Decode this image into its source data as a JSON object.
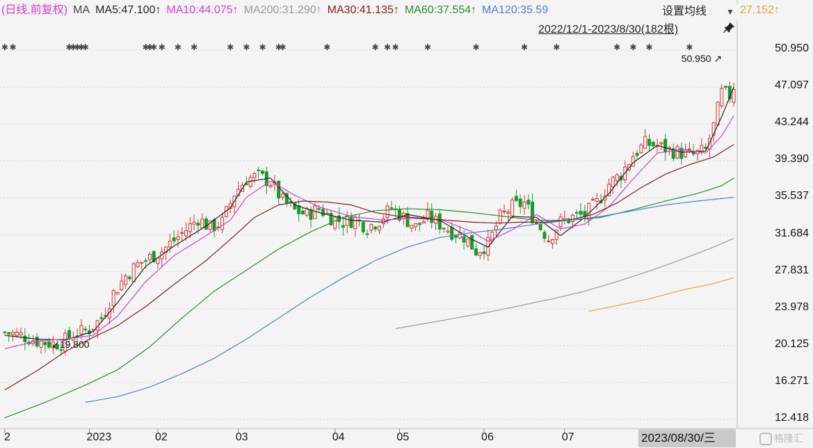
{
  "legend": {
    "prefix": "(日线,前复权)",
    "ma_label": "MA",
    "items": [
      {
        "label": "MA5:47.100↑",
        "color": "#222222"
      },
      {
        "label": "MA10:44.075↑",
        "color": "#d63bd6"
      },
      {
        "label": "MA200:31.290↑",
        "color": "#999999"
      },
      {
        "label": "MA30:41.135↑",
        "color": "#8b1a1a"
      },
      {
        "label": "MA60:37.554↑",
        "color": "#2e8b2e"
      },
      {
        "label": "MA120:35.59",
        "color": "#4a7fd4"
      },
      {
        "label": "27.152↑",
        "color": "#e8a33c"
      }
    ]
  },
  "settings_button": {
    "label": "设置均线"
  },
  "range_label": "2022/12/1-2023/8/30(182根)",
  "date_badge": "2023/08/30/三",
  "watermark": "格隆汇",
  "colors": {
    "up": "#e03030",
    "down": "#1a9a2a",
    "background": "#f4f4f4",
    "grid": "#d6d6d6"
  },
  "chart_data": {
    "type": "candlestick",
    "y_ticks": [
      "50.950",
      "47.097",
      "43.244",
      "39.390",
      "35.537",
      "31.684",
      "27.831",
      "23.978",
      "20.125",
      "16.271",
      "12.418"
    ],
    "ylim": [
      12.418,
      50.95
    ],
    "x_ticks": [
      {
        "label": "2",
        "index": 0
      },
      {
        "label": "2023",
        "index": 21
      },
      {
        "label": "02",
        "index": 38
      },
      {
        "label": "03",
        "index": 58
      },
      {
        "label": "04",
        "index": 82
      },
      {
        "label": "05",
        "index": 98
      },
      {
        "label": "06",
        "index": 119
      },
      {
        "label": "07",
        "index": 139
      },
      {
        "label": "08",
        "index": 158
      }
    ],
    "n_candles": 182,
    "annotations": [
      {
        "text": "19.800",
        "index": 14,
        "value": 19.8,
        "arrow": "↙"
      },
      {
        "text": "50.950",
        "index": 178,
        "value": 50.95,
        "arrow": "↗"
      }
    ],
    "close_anchors": [
      [
        0,
        21.5
      ],
      [
        4,
        21.2
      ],
      [
        8,
        20.6
      ],
      [
        12,
        20.3
      ],
      [
        14,
        20.4
      ],
      [
        17,
        21.3
      ],
      [
        21,
        21.8
      ],
      [
        24,
        23.0
      ],
      [
        27,
        25.6
      ],
      [
        30,
        27.4
      ],
      [
        33,
        28.6
      ],
      [
        36,
        29.3
      ],
      [
        39,
        30.0
      ],
      [
        42,
        31.1
      ],
      [
        45,
        32.2
      ],
      [
        48,
        33.4
      ],
      [
        51,
        32.4
      ],
      [
        54,
        33.0
      ],
      [
        57,
        36.0
      ],
      [
        60,
        37.5
      ],
      [
        63,
        37.8
      ],
      [
        66,
        37.2
      ],
      [
        69,
        35.2
      ],
      [
        72,
        34.2
      ],
      [
        75,
        33.8
      ],
      [
        78,
        34.4
      ],
      [
        81,
        33.5
      ],
      [
        84,
        33.0
      ],
      [
        87,
        33.3
      ],
      [
        90,
        32.5
      ],
      [
        93,
        33.2
      ],
      [
        96,
        34.5
      ],
      [
        99,
        33.5
      ],
      [
        102,
        32.5
      ],
      [
        105,
        33.5
      ],
      [
        108,
        32.8
      ],
      [
        111,
        32.0
      ],
      [
        114,
        31.5
      ],
      [
        117,
        30.0
      ],
      [
        120,
        30.7
      ],
      [
        123,
        33.5
      ],
      [
        126,
        34.6
      ],
      [
        129,
        35.0
      ],
      [
        132,
        33.0
      ],
      [
        135,
        31.3
      ],
      [
        138,
        33.0
      ],
      [
        141,
        33.5
      ],
      [
        144,
        33.8
      ],
      [
        147,
        35.0
      ],
      [
        150,
        37.0
      ],
      [
        153,
        38.0
      ],
      [
        156,
        40.0
      ],
      [
        159,
        41.2
      ],
      [
        162,
        41.0
      ],
      [
        165,
        40.5
      ],
      [
        168,
        40.2
      ],
      [
        171,
        40.0
      ],
      [
        174,
        40.5
      ],
      [
        176,
        43.0
      ],
      [
        178,
        46.5
      ],
      [
        180,
        46.2
      ],
      [
        181,
        47.2
      ]
    ],
    "ma_lines": {
      "ma5": {
        "color": "#222222",
        "start": 0,
        "points": [
          [
            0,
            21.2
          ],
          [
            8,
            20.8
          ],
          [
            15,
            20.7
          ],
          [
            22,
            21.6
          ],
          [
            28,
            24.6
          ],
          [
            35,
            28.4
          ],
          [
            42,
            30.5
          ],
          [
            50,
            32.6
          ],
          [
            56,
            34.5
          ],
          [
            60,
            37.2
          ],
          [
            66,
            37.6
          ],
          [
            72,
            34.8
          ],
          [
            78,
            34.0
          ],
          [
            86,
            33.2
          ],
          [
            94,
            33.0
          ],
          [
            100,
            33.8
          ],
          [
            108,
            33.2
          ],
          [
            116,
            31.2
          ],
          [
            120,
            30.4
          ],
          [
            126,
            33.6
          ],
          [
            132,
            33.5
          ],
          [
            138,
            31.6
          ],
          [
            144,
            33.5
          ],
          [
            150,
            36.0
          ],
          [
            156,
            39.2
          ],
          [
            162,
            41.0
          ],
          [
            168,
            40.3
          ],
          [
            174,
            40.4
          ],
          [
            178,
            44.0
          ],
          [
            181,
            47.1
          ]
        ]
      },
      "ma10": {
        "color": "#d63bd6",
        "start": 0,
        "points": [
          [
            0,
            19.8
          ],
          [
            8,
            20.6
          ],
          [
            15,
            20.8
          ],
          [
            22,
            21.2
          ],
          [
            28,
            23.2
          ],
          [
            35,
            26.8
          ],
          [
            42,
            29.5
          ],
          [
            50,
            31.6
          ],
          [
            56,
            33.2
          ],
          [
            60,
            35.6
          ],
          [
            66,
            37.3
          ],
          [
            72,
            35.8
          ],
          [
            78,
            34.6
          ],
          [
            86,
            33.6
          ],
          [
            94,
            33.2
          ],
          [
            100,
            33.4
          ],
          [
            108,
            33.3
          ],
          [
            116,
            32.0
          ],
          [
            120,
            31.0
          ],
          [
            126,
            32.2
          ],
          [
            132,
            33.8
          ],
          [
            138,
            32.3
          ],
          [
            144,
            32.8
          ],
          [
            150,
            34.6
          ],
          [
            156,
            37.5
          ],
          [
            162,
            40.2
          ],
          [
            168,
            40.6
          ],
          [
            174,
            40.2
          ],
          [
            178,
            42.0
          ],
          [
            181,
            44.1
          ]
        ]
      },
      "ma30": {
        "color": "#8b1a1a",
        "start": 0,
        "points": [
          [
            0,
            15.5
          ],
          [
            8,
            17.5
          ],
          [
            15,
            19.5
          ],
          [
            22,
            21.0
          ],
          [
            28,
            22.2
          ],
          [
            35,
            24.2
          ],
          [
            42,
            26.5
          ],
          [
            50,
            29.0
          ],
          [
            56,
            31.2
          ],
          [
            62,
            33.5
          ],
          [
            68,
            34.8
          ],
          [
            74,
            35.2
          ],
          [
            80,
            35.1
          ],
          [
            86,
            34.8
          ],
          [
            92,
            34.0
          ],
          [
            98,
            33.6
          ],
          [
            104,
            33.4
          ],
          [
            110,
            33.2
          ],
          [
            116,
            33.0
          ],
          [
            122,
            32.9
          ],
          [
            128,
            33.0
          ],
          [
            134,
            33.0
          ],
          [
            140,
            33.2
          ],
          [
            146,
            33.8
          ],
          [
            152,
            35.0
          ],
          [
            158,
            36.6
          ],
          [
            164,
            38.0
          ],
          [
            170,
            39.0
          ],
          [
            176,
            39.8
          ],
          [
            181,
            41.1
          ]
        ]
      },
      "ma60": {
        "color": "#2e8b2e",
        "start": 0,
        "points": [
          [
            0,
            12.6
          ],
          [
            10,
            14.2
          ],
          [
            20,
            16.0
          ],
          [
            28,
            17.6
          ],
          [
            36,
            20.0
          ],
          [
            44,
            23.0
          ],
          [
            52,
            25.8
          ],
          [
            60,
            28.0
          ],
          [
            68,
            30.2
          ],
          [
            76,
            32.0
          ],
          [
            84,
            33.5
          ],
          [
            92,
            34.2
          ],
          [
            100,
            34.4
          ],
          [
            108,
            34.3
          ],
          [
            116,
            34.0
          ],
          [
            124,
            33.6
          ],
          [
            132,
            33.2
          ],
          [
            140,
            33.2
          ],
          [
            148,
            33.5
          ],
          [
            156,
            34.3
          ],
          [
            164,
            35.2
          ],
          [
            172,
            36.0
          ],
          [
            178,
            36.8
          ],
          [
            181,
            37.6
          ]
        ]
      },
      "ma120": {
        "color": "#4a7fd4",
        "start": 20,
        "points": [
          [
            20,
            14.2
          ],
          [
            28,
            14.8
          ],
          [
            36,
            15.8
          ],
          [
            44,
            17.2
          ],
          [
            52,
            18.8
          ],
          [
            60,
            20.8
          ],
          [
            68,
            23.0
          ],
          [
            76,
            25.2
          ],
          [
            84,
            27.2
          ],
          [
            92,
            29.0
          ],
          [
            100,
            30.4
          ],
          [
            108,
            31.4
          ],
          [
            116,
            31.9
          ],
          [
            124,
            32.3
          ],
          [
            132,
            32.8
          ],
          [
            140,
            33.2
          ],
          [
            148,
            33.6
          ],
          [
            156,
            34.2
          ],
          [
            164,
            34.8
          ],
          [
            172,
            35.2
          ],
          [
            181,
            35.6
          ]
        ]
      },
      "ma200": {
        "color": "#999999",
        "start": 97,
        "points": [
          [
            97,
            21.9
          ],
          [
            104,
            22.4
          ],
          [
            112,
            23.0
          ],
          [
            120,
            23.6
          ],
          [
            128,
            24.3
          ],
          [
            136,
            25.0
          ],
          [
            144,
            25.8
          ],
          [
            152,
            26.8
          ],
          [
            160,
            27.9
          ],
          [
            168,
            29.1
          ],
          [
            176,
            30.4
          ],
          [
            181,
            31.3
          ]
        ]
      },
      "ma250": {
        "color": "#e8a33c",
        "start": 145,
        "points": [
          [
            145,
            23.7
          ],
          [
            152,
            24.3
          ],
          [
            160,
            25.0
          ],
          [
            168,
            25.9
          ],
          [
            176,
            26.6
          ],
          [
            181,
            27.2
          ]
        ]
      }
    },
    "dividend_marks": [
      0,
      2,
      16,
      17,
      18,
      19,
      20,
      35,
      36,
      37,
      39,
      43,
      47,
      56,
      60,
      64,
      68,
      69,
      80,
      92,
      95,
      97,
      105,
      117,
      129,
      137,
      152,
      156,
      160,
      170
    ]
  }
}
